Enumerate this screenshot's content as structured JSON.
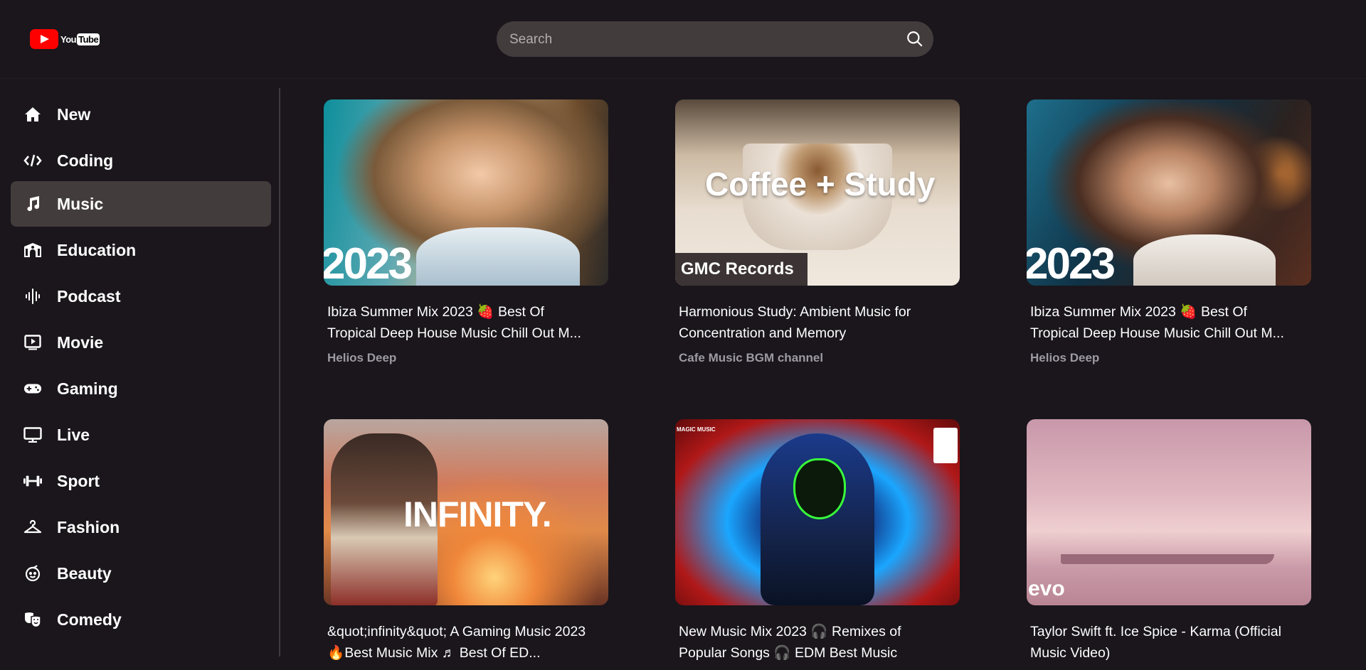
{
  "header": {
    "logo": {
      "you": "You",
      "tube": "Tube"
    },
    "search": {
      "placeholder": "Search",
      "icon": "search-icon"
    }
  },
  "sidebar": {
    "items": [
      {
        "label": "New",
        "icon": "home-icon"
      },
      {
        "label": "Coding",
        "icon": "code-icon"
      },
      {
        "label": "Music",
        "icon": "music-note-icon",
        "active": true
      },
      {
        "label": "Education",
        "icon": "school-icon"
      },
      {
        "label": "Podcast",
        "icon": "podcast-waveform-icon"
      },
      {
        "label": "Movie",
        "icon": "movie-play-icon"
      },
      {
        "label": "Gaming",
        "icon": "gamepad-icon"
      },
      {
        "label": "Live",
        "icon": "monitor-icon"
      },
      {
        "label": "Sport",
        "icon": "dumbbell-icon"
      },
      {
        "label": "Fashion",
        "icon": "hanger-icon"
      },
      {
        "label": "Beauty",
        "icon": "face-icon"
      },
      {
        "label": "Comedy",
        "icon": "theater-masks-icon"
      }
    ]
  },
  "videos": [
    {
      "title_line1": "Ibiza Summer Mix 2023 🍓 Best Of",
      "title_line2": "Tropical Deep House Music Chill Out M...",
      "channel": "Helios Deep",
      "thumb_text": "2023"
    },
    {
      "title_line1": "Harmonious Study: Ambient Music for",
      "title_line2": "Concentration and Memory",
      "channel": "Cafe Music BGM channel",
      "thumb_text": "Coffee + Study",
      "thumb_badge": "GMC Records"
    },
    {
      "title_line1": "Ibiza Summer Mix 2023 🍓 Best Of",
      "title_line2": "Tropical Deep House Music Chill Out M...",
      "channel": "Helios Deep",
      "thumb_text": "2023"
    },
    {
      "title_line1": "&quot;infinity&quot; A Gaming Music 2023",
      "title_line2": "🔥Best Music Mix ♬ Best Of ED...",
      "channel": "",
      "thumb_text": "INFINITY."
    },
    {
      "title_line1": "New Music Mix 2023 🎧 Remixes of",
      "title_line2": "Popular Songs 🎧 EDM Best Music",
      "channel": "",
      "thumb_text": "MAGIC MUSIC"
    },
    {
      "title_line1": "Taylor Swift ft. Ice Spice - Karma (Official",
      "title_line2": "Music Video)",
      "channel": "",
      "thumb_text": "evo"
    }
  ],
  "colors": {
    "background": "#1a161c",
    "active": "#433c3d",
    "brand_red": "#ff0000",
    "channel_text": "#9d9aa2"
  }
}
